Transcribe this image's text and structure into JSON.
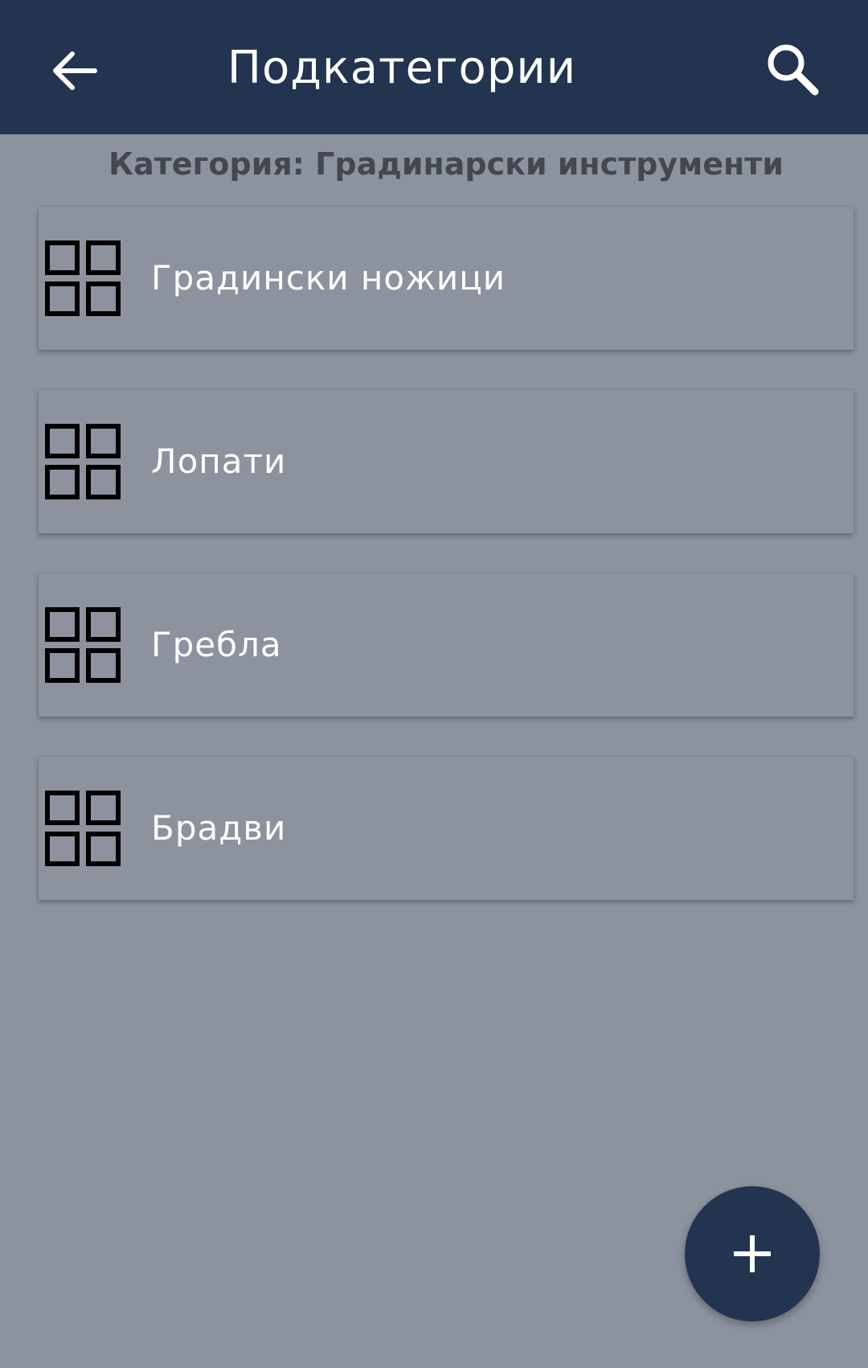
{
  "app_bar": {
    "title": "Подкатегории",
    "back_icon": "arrow-left-icon",
    "search_icon": "search-icon",
    "background_color": "#22344f"
  },
  "category_label": "Категория: Градинарски инструменти",
  "subcategories": [
    {
      "label": "Градински ножици",
      "icon": "grid-icon"
    },
    {
      "label": "Лопати",
      "icon": "grid-icon"
    },
    {
      "label": "Гребла",
      "icon": "grid-icon"
    },
    {
      "label": "Брадви",
      "icon": "grid-icon"
    }
  ],
  "fab": {
    "icon": "plus-icon",
    "color": "#22344f"
  },
  "colors": {
    "background": "#8c939f",
    "text_light": "#ffffff",
    "text_dark": "#434850"
  }
}
